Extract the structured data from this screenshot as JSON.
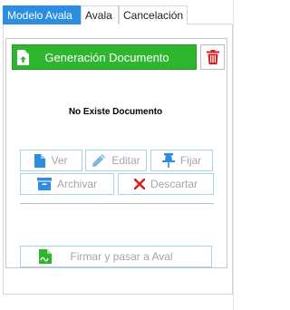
{
  "tabs": [
    {
      "label": "Modelo Avala",
      "active": true
    },
    {
      "label": "Avala",
      "active": false
    },
    {
      "label": "Cancelación",
      "active": false
    }
  ],
  "document": {
    "generate_label": "Generación Documento",
    "generate_icon": "file-upload-icon",
    "delete_icon": "trash-icon",
    "status_text": "No Existe Documento"
  },
  "actions": {
    "ver": {
      "label": "Ver",
      "icon": "file-icon"
    },
    "editar": {
      "label": "Editar",
      "icon": "pencil-icon"
    },
    "fijar": {
      "label": "Fijar",
      "icon": "pin-icon"
    },
    "archivar": {
      "label": "Archivar",
      "icon": "archive-icon"
    },
    "descartar": {
      "label": "Descartar",
      "icon": "x-icon"
    }
  },
  "firmar": {
    "label": "Firmar y pasar a Aval",
    "icon": "signature-icon"
  },
  "colors": {
    "accent": "#2d8de0",
    "generate_green": "#2fb62f",
    "danger": "#d42020",
    "disabled_icon": "#7fb8dc",
    "disabled_border": "#a9d4e6"
  }
}
